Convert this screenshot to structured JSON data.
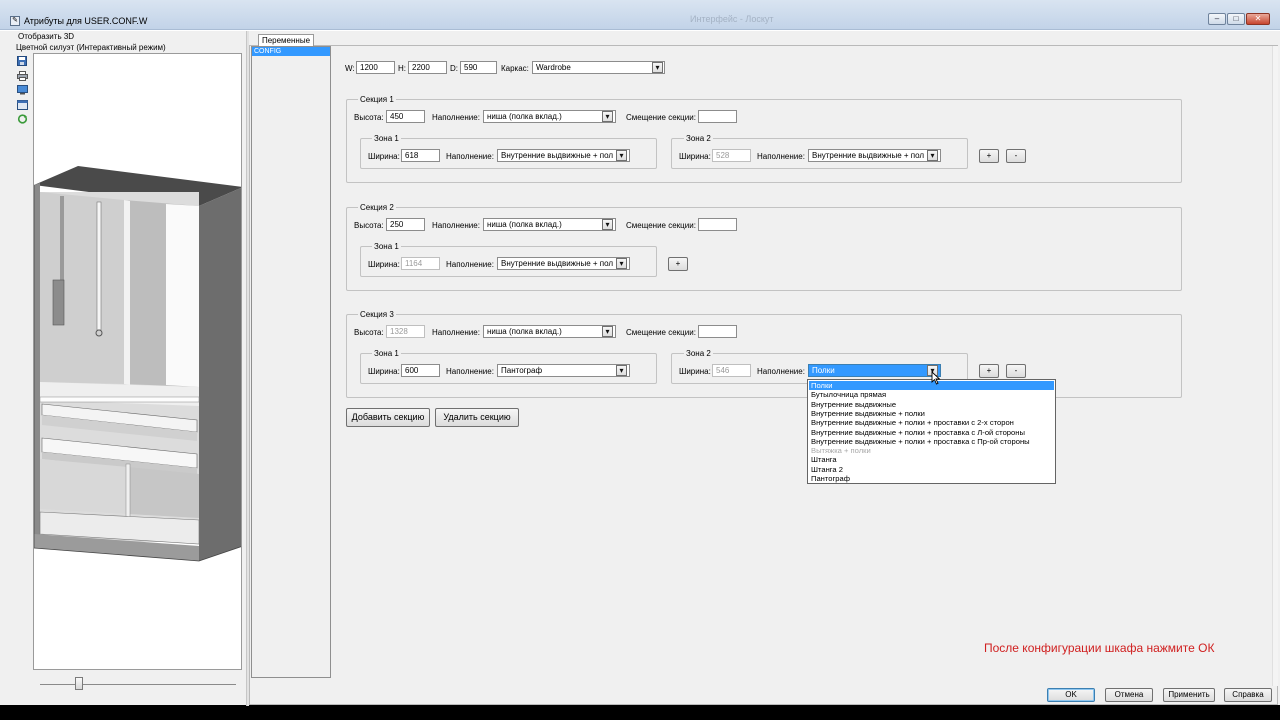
{
  "window": {
    "title": "Атрибуты для USER.CONF.W",
    "faint_title": "Интерфейс - Лоскут",
    "min": "–",
    "max": "□",
    "close": "✕"
  },
  "left_panel": {
    "menu": "Отобразить 3D",
    "mode": "Цветной силуэт (Интерактивный режим)",
    "tools": [
      "save-icon",
      "print-icon",
      "monitor-icon",
      "window-icon",
      "refresh-icon"
    ],
    "zoom_fraction": 0.2
  },
  "tabs": {
    "variables": "Переменные"
  },
  "tree": {
    "item": "CONFIG"
  },
  "dims": {
    "w_label": "W:",
    "w": "1200",
    "h_label": "H:",
    "h": "2200",
    "d_label": "D:",
    "d": "590",
    "frame_label": "Каркас:",
    "frame": "Wardrobe"
  },
  "labels": {
    "height": "Высота:",
    "fill": "Наполнение:",
    "offset": "Смещение секции:",
    "width": "Ширина:",
    "plus": "+",
    "minus": "-"
  },
  "sections": [
    {
      "title": "Секция 1",
      "height": "450",
      "fill": "ниша (полка вклад.)",
      "offset": "",
      "zones": [
        {
          "title": "Зона 1",
          "width": "618",
          "fill": "Внутренние выдвижные + пол"
        },
        {
          "title": "Зона 2",
          "width": "528",
          "fill": "Внутренние выдвижные + пол"
        }
      ]
    },
    {
      "title": "Секция 2",
      "height": "250",
      "fill": "ниша (полка вклад.)",
      "offset": "",
      "zones": [
        {
          "title": "Зона 1",
          "width": "1164",
          "fill": "Внутренние выдвижные + пол"
        }
      ]
    },
    {
      "title": "Секция 3",
      "height": "1328",
      "fill": "ниша (полка вклад.)",
      "offset": "",
      "zones": [
        {
          "title": "Зона 1",
          "width": "600",
          "fill": "Пантограф"
        },
        {
          "title": "Зона 2",
          "width": "546",
          "fill": "Полки"
        }
      ]
    }
  ],
  "buttons": {
    "add_section": "Добавить секцию",
    "remove_section": "Удалить секцию",
    "ok": "OK",
    "cancel": "Отмена",
    "apply": "Применить",
    "help": "Справка"
  },
  "dropdown": {
    "options": [
      "Полки",
      "Бутылочница прямая",
      "Внутренние выдвижные",
      "Внутренние выдвижные + полки",
      "Внутренние выдвижные + полки + проставки с 2-х сторон",
      "Внутренние выдвижные + полки + проставка с Л-ой стороны",
      "Внутренние выдвижные + полки + проставка с Пр-ой стороны",
      "Вытяжка + полки",
      "Штанга",
      "Штанга 2",
      "Пантограф"
    ],
    "selected": "Полки",
    "disabled": "Вытяжка + полки"
  },
  "hint": "После конфигурации шкафа нажмите ОК",
  "colors": {
    "accent": "#3399ff",
    "hint": "#d02020"
  }
}
